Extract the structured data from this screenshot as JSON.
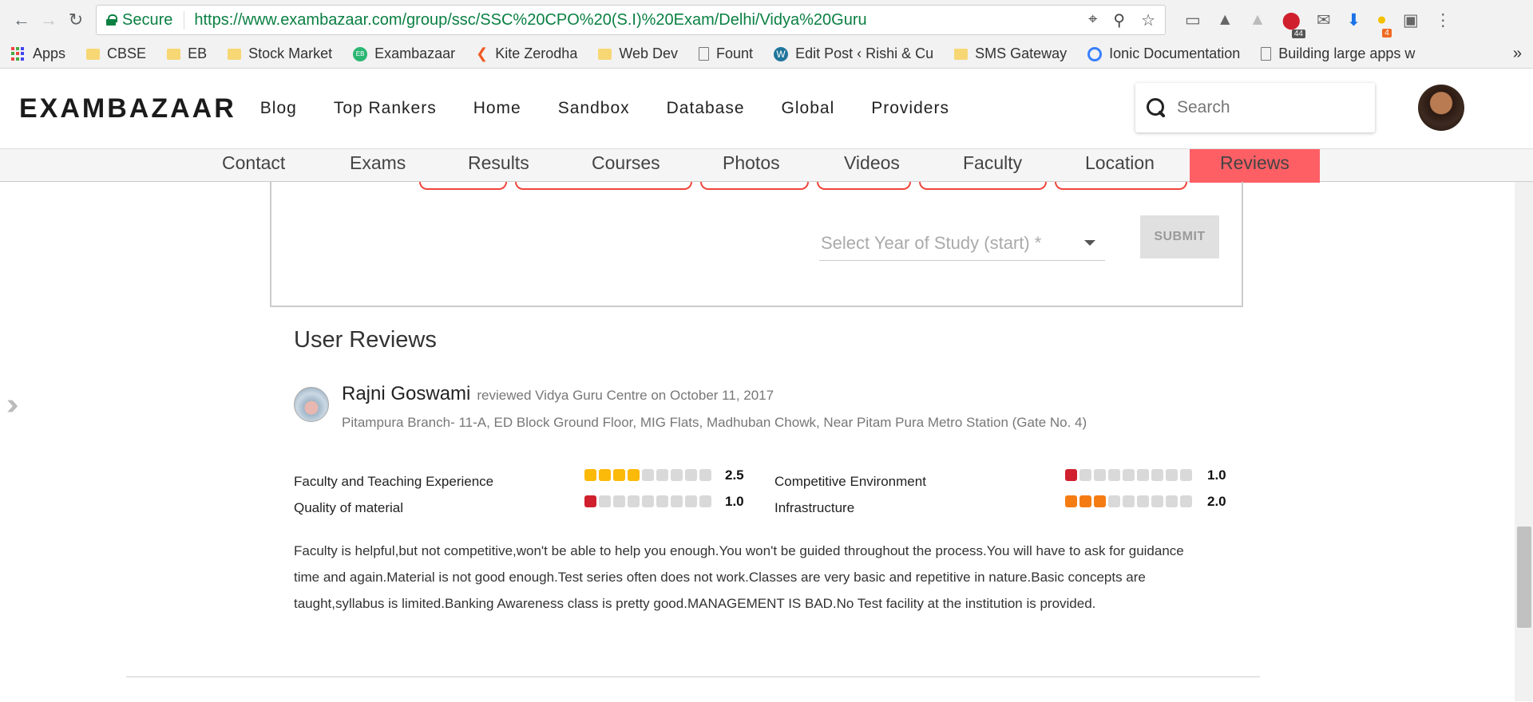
{
  "browser": {
    "secure_label": "Secure",
    "url": "https://www.exambazaar.com/group/ssc/SSC%20CPO%20(S.I)%20Exam/Delhi/Vidya%20Guru",
    "ext_badges": [
      "44",
      "4"
    ]
  },
  "bookmarks": [
    {
      "label": "Apps",
      "icon": "apps-grid-icon"
    },
    {
      "label": "CBSE",
      "icon": "folder-icon"
    },
    {
      "label": "EB",
      "icon": "folder-icon"
    },
    {
      "label": "Stock Market",
      "icon": "folder-icon"
    },
    {
      "label": "Exambazaar",
      "icon": "exambazaar-icon"
    },
    {
      "label": "Kite Zerodha",
      "icon": "kite-icon"
    },
    {
      "label": "Web Dev",
      "icon": "folder-icon"
    },
    {
      "label": "Fount",
      "icon": "page-icon"
    },
    {
      "label": "Edit Post ‹ Rishi & Cu",
      "icon": "wordpress-icon"
    },
    {
      "label": "SMS Gateway",
      "icon": "folder-icon"
    },
    {
      "label": "Ionic Documentation",
      "icon": "ionic-icon"
    },
    {
      "label": "Building large apps w",
      "icon": "page-icon"
    }
  ],
  "header": {
    "logo": "EXAMBAZAAR",
    "nav": [
      "Blog",
      "Top Rankers",
      "Home",
      "Sandbox",
      "Database",
      "Global",
      "Providers"
    ],
    "search_placeholder": "Search"
  },
  "subnav": {
    "items": [
      "Contact",
      "Exams",
      "Results",
      "Courses",
      "Photos",
      "Videos",
      "Faculty",
      "Location",
      "Reviews"
    ],
    "active": "Reviews",
    "active_color": "#fe5f65"
  },
  "form": {
    "year_placeholder": "Select Year of Study (start) *",
    "submit_label": "SUBMIT"
  },
  "reviews": {
    "title": "User Reviews",
    "items": [
      {
        "name": "Rajni Goswami",
        "meta": "reviewed Vidya Guru Centre on October 11, 2017",
        "address": "Pitampura Branch- 11-A, ED Block Ground Floor, MIG Flats, Madhuban Chowk, Near Pitam Pura Metro Station (Gate No. 4)",
        "ratings": [
          {
            "label": "Faculty and Teaching Experience",
            "value": "2.5",
            "filled": 4,
            "color": "#fbb90a"
          },
          {
            "label": "Competitive Environment",
            "value": "1.0",
            "filled": 1,
            "color": "#d0202e"
          },
          {
            "label": "Quality of material",
            "value": "1.0",
            "filled": 1,
            "color": "#d0202e"
          },
          {
            "label": "Infrastructure",
            "value": "2.0",
            "filled": 3,
            "color": "#f57c12"
          }
        ],
        "text": "Faculty is helpful,but not competitive,won't be able to help you enough.You won't be guided throughout the process.You will have to ask for guidance time and again.Material is not good enough.Test series often does not work.Classes are very basic and repetitive in nature.Basic concepts are taught,syllabus is limited.Banking Awareness class is pretty good.MANAGEMENT IS BAD.No Test facility at the institution is provided."
      }
    ]
  }
}
